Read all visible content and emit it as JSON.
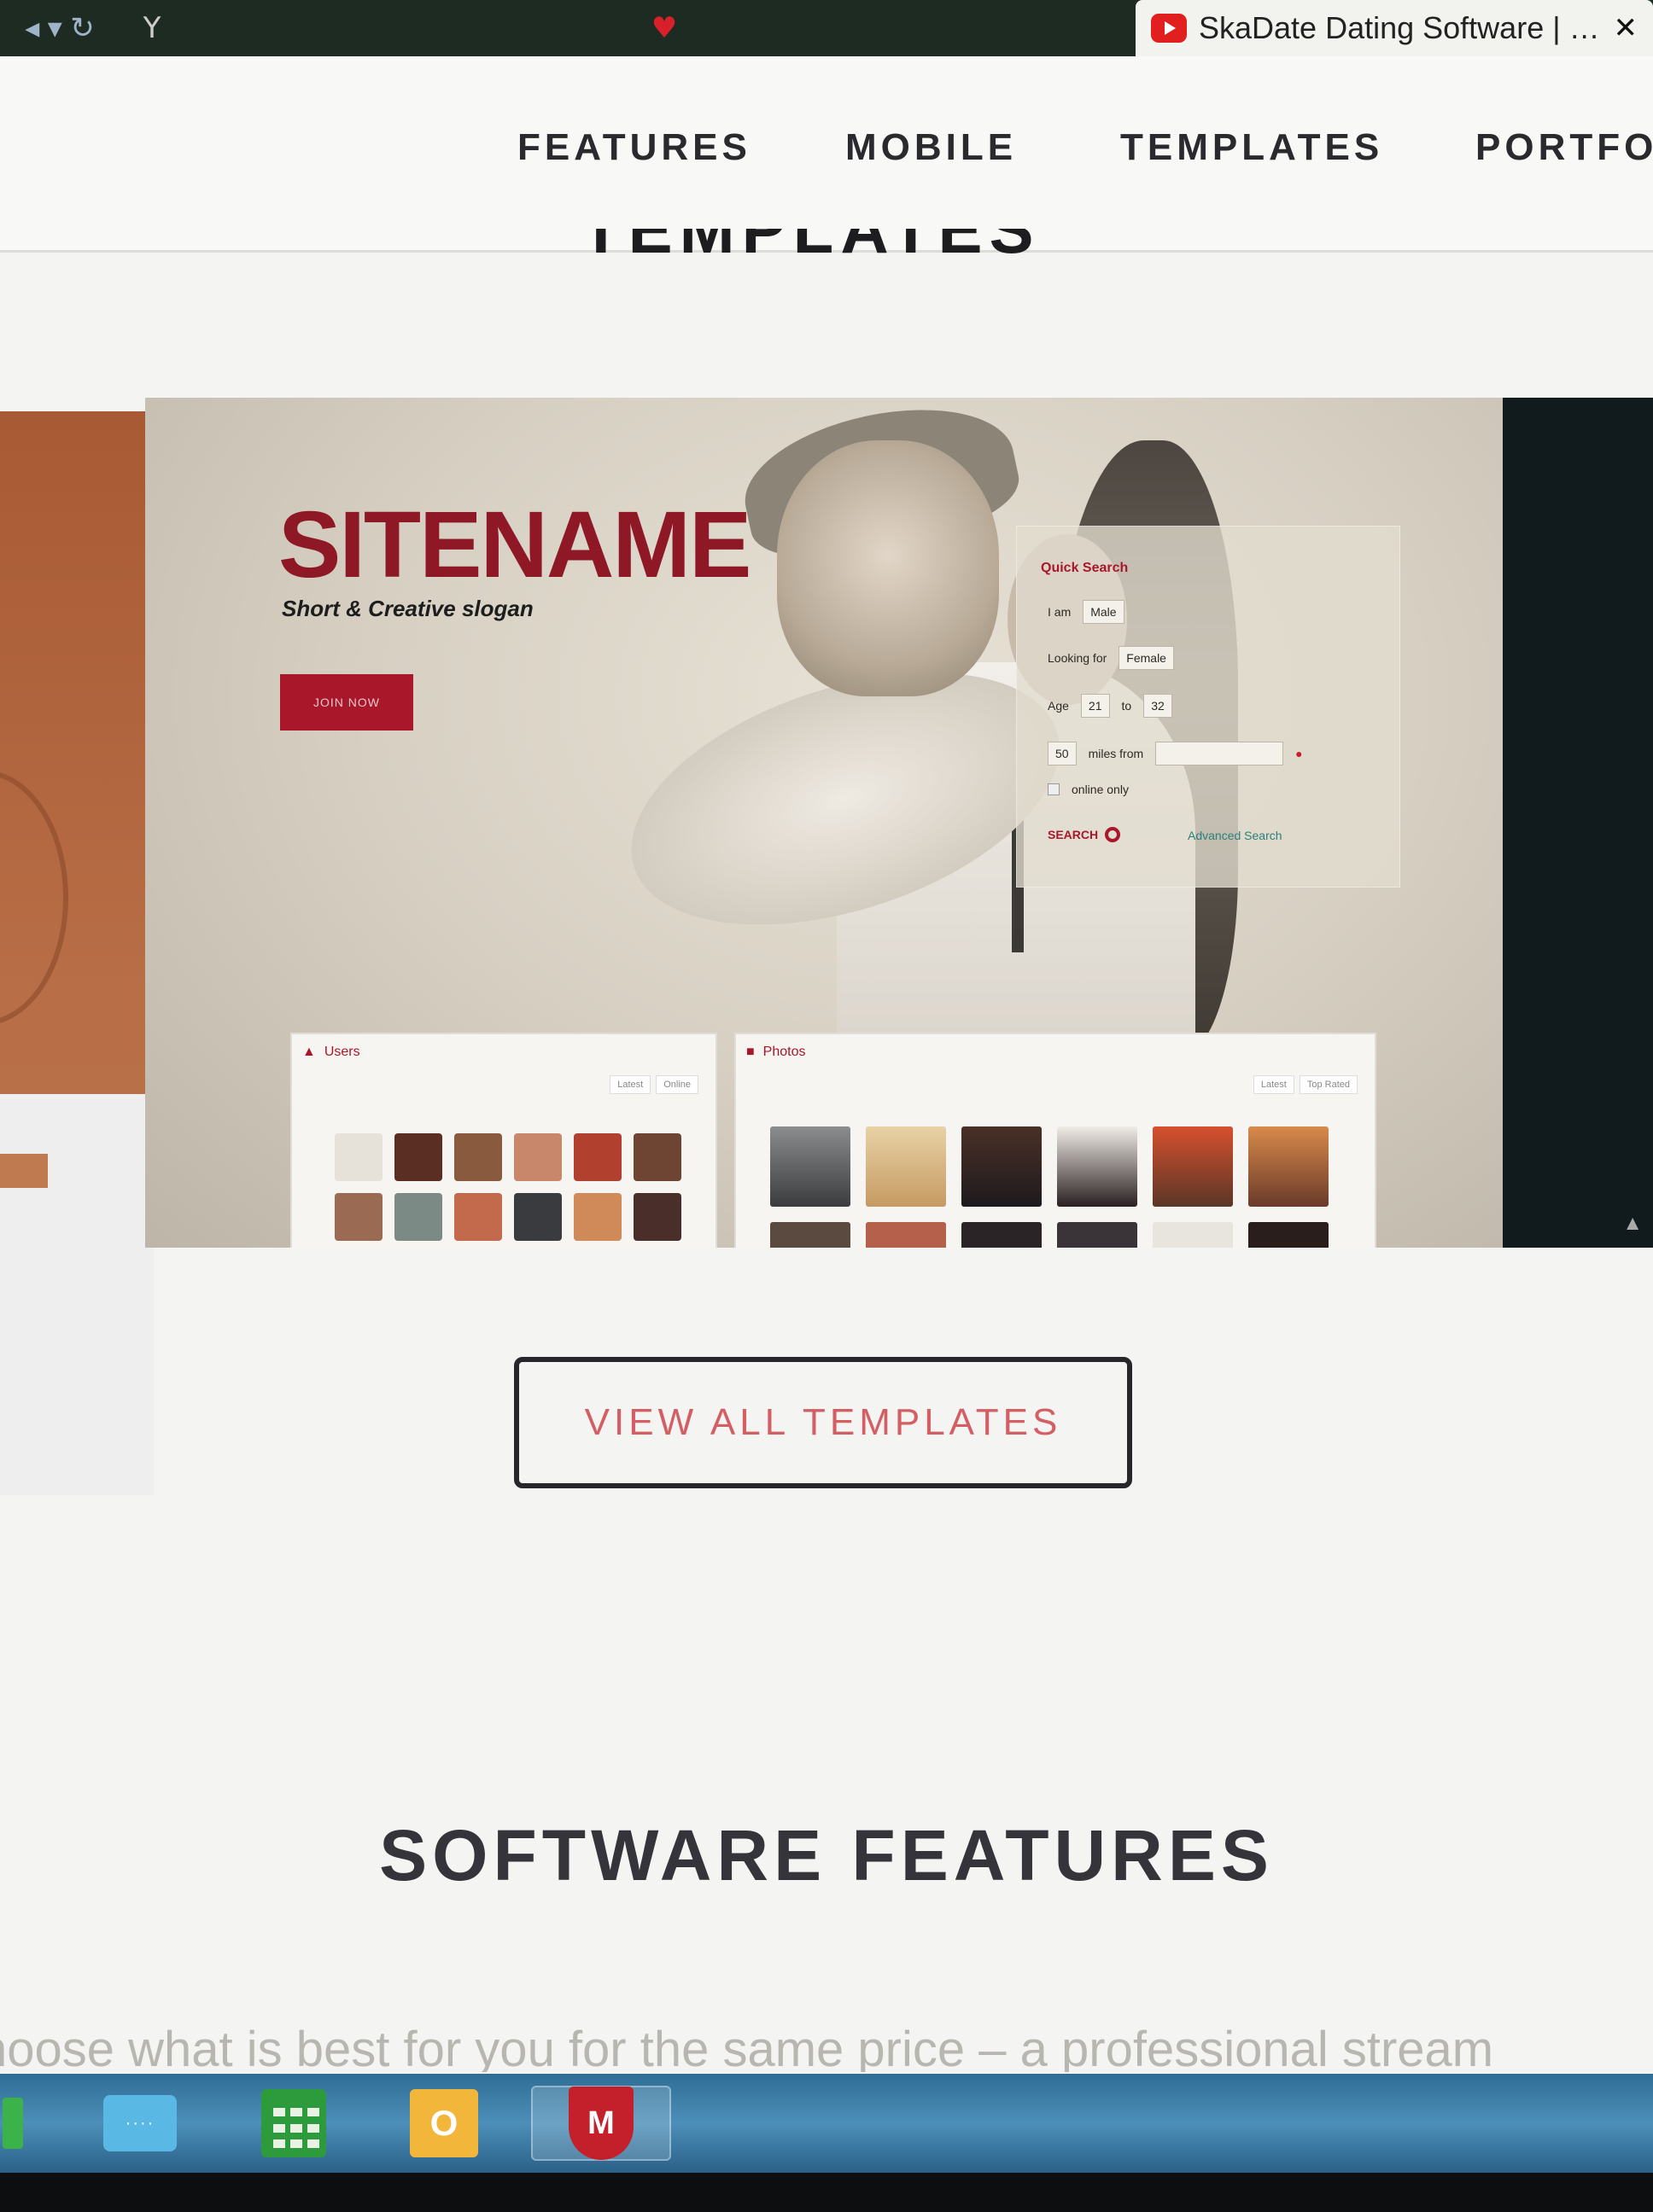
{
  "browser": {
    "nav_icon": "◂ ▾ ↻",
    "tabs": [
      {
        "favicon": "Y",
        "title": "",
        "active": false
      },
      {
        "favicon": "heart-icon",
        "title": "",
        "active": false
      },
      {
        "favicon": "youtube-icon",
        "title": "SkaDate Dating Software | D...",
        "active": true,
        "close": "✕"
      }
    ]
  },
  "site_nav": {
    "items": [
      "FEATURES",
      "MOBILE",
      "TEMPLATES",
      "PORTFOL"
    ]
  },
  "section_heading_clipped": "TEMPLATES",
  "carousel": {
    "template_preview": {
      "brand": "SITENAME",
      "slogan": "Short & Creative slogan",
      "join_button": "JOIN NOW",
      "quick_search": {
        "title": "Quick Search",
        "i_am_label": "I am",
        "i_am_value": "Male",
        "looking_for_label": "Looking for",
        "looking_for_value": "Female",
        "age_label": "Age",
        "age_from": "21",
        "age_to_label": "to",
        "age_to": "32",
        "miles_value": "50",
        "miles_label": "miles from",
        "online_only": "online only",
        "search_button": "SEARCH",
        "advanced_link": "Advanced Search"
      },
      "users_widget": {
        "title": "Users",
        "tabs": [
          "Latest",
          "Online"
        ]
      },
      "photo_widget": {
        "title": "Photos",
        "tabs": [
          "Latest",
          "Top Rated"
        ]
      }
    }
  },
  "cta": {
    "view_all": "VIEW ALL TEMPLATES"
  },
  "features": {
    "title": "SOFTWARE FEATURES",
    "intro_clipped": "hoose what is best for you for the same price – a professional stream"
  },
  "colors": {
    "brand_red": "#8f1826",
    "cta_text": "#d35f64",
    "taskbar": "#3f82ad"
  },
  "taskbar": {
    "items": [
      "network-icon",
      "calculator-icon",
      "outlook-icon",
      "mcafee-icon"
    ],
    "outlook_glyph": "O",
    "mcafee_glyph": "M"
  }
}
